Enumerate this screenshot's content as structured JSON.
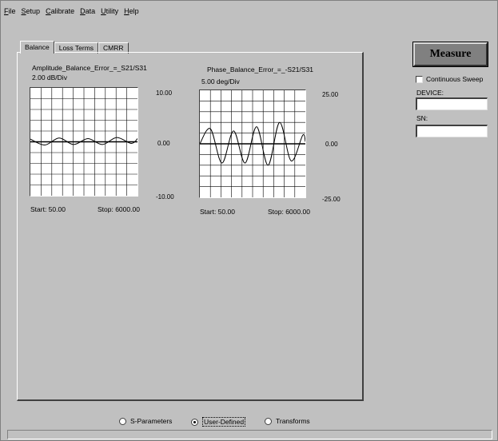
{
  "menu": [
    {
      "mnemonic": "F",
      "rest": "ile"
    },
    {
      "mnemonic": "S",
      "rest": "etup"
    },
    {
      "mnemonic": "C",
      "rest": "alibrate"
    },
    {
      "mnemonic": "D",
      "rest": "ata"
    },
    {
      "mnemonic": "U",
      "rest": "tility"
    },
    {
      "mnemonic": "H",
      "rest": "elp"
    }
  ],
  "tabs": [
    "Balance",
    "Loss Terms",
    "CMRR"
  ],
  "active_tab": "Balance",
  "plots": {
    "amplitude": {
      "title": "Amplitude_Balance_Error_=_S21/S31",
      "scale": "2.00 dB/Div",
      "y_top": "10.00",
      "y_mid": "0.00",
      "y_bot": "-10.00",
      "start": "Start: 50.00",
      "stop": "Stop:  6000.00"
    },
    "phase": {
      "title": "Phase_Balance_Error_=_-S21/S31",
      "scale": "5.00 deg/Div",
      "y_top": "25.00",
      "y_mid": "0.00",
      "y_bot": "-25.00",
      "start": "Start: 50.00",
      "stop": "Stop:  6000.00"
    }
  },
  "chart_data": [
    {
      "type": "line",
      "title": "Amplitude_Balance_Error_=_S21/S31",
      "ylabel": "2.00 dB/Div",
      "xlim": [
        50,
        6000
      ],
      "ylim": [
        -10,
        10
      ],
      "grid": true,
      "x": [
        50,
        850,
        1650,
        2450,
        3250,
        4050,
        4850,
        5650,
        6000
      ],
      "y": [
        0.5,
        -0.6,
        0.7,
        -0.5,
        0.6,
        -0.5,
        0.8,
        -0.3,
        0.6
      ]
    },
    {
      "type": "line",
      "title": "Phase_Balance_Error_=_-S21/S31",
      "ylabel": "5.00 deg/Div",
      "xlim": [
        50,
        6000
      ],
      "ylim": [
        -25,
        25
      ],
      "grid": true,
      "x": [
        50,
        650,
        1300,
        1950,
        2600,
        3250,
        3900,
        4550,
        5200,
        5850,
        6000
      ],
      "y": [
        0,
        7,
        -9,
        6,
        -9,
        8,
        -10,
        10,
        -8,
        4,
        1
      ]
    }
  ],
  "measure_label": "Measure",
  "continuous_sweep_label": "Continuous Sweep",
  "device_label": "DEVICE:",
  "device_value": "",
  "sn_label": "SN:",
  "sn_value": "",
  "radios": [
    {
      "label": "S-Parameters",
      "selected": false
    },
    {
      "label": "User-Defined",
      "selected": true
    },
    {
      "label": "Transforms",
      "selected": false
    }
  ]
}
